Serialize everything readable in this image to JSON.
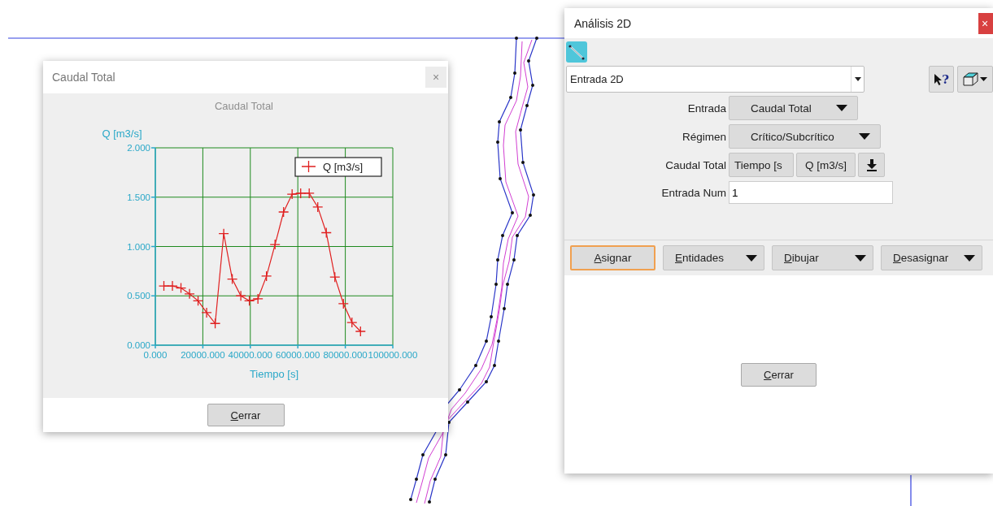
{
  "chart_window": {
    "title": "Caudal Total",
    "close_label": "×",
    "close_button": "Cerrar",
    "chart_data": {
      "type": "line",
      "title": "Caudal Total",
      "xlabel": "Tiempo [s]",
      "ylabel": "Q [m3/s]",
      "x": [
        3600,
        7200,
        10800,
        14400,
        18000,
        21600,
        25200,
        28800,
        32400,
        36000,
        39600,
        43200,
        46800,
        50400,
        54000,
        57600,
        61200,
        64800,
        68400,
        72000,
        75600,
        79200,
        82800,
        86400
      ],
      "grid": true,
      "series": [
        {
          "name": "Q [m3/s]",
          "color": "#e02020",
          "marker": "+",
          "values": [
            0.6,
            0.6,
            0.58,
            0.52,
            0.45,
            0.33,
            0.22,
            1.13,
            0.67,
            0.5,
            0.45,
            0.47,
            0.7,
            1.02,
            1.35,
            1.53,
            1.54,
            1.54,
            1.4,
            1.14,
            0.69,
            0.42,
            0.23,
            0.14
          ]
        }
      ],
      "xlim": [
        0,
        100000
      ],
      "ylim": [
        0,
        2
      ],
      "xticks": [
        {
          "value": 0,
          "label": "0.000"
        },
        {
          "value": 20000,
          "label": "20000.000"
        },
        {
          "value": 40000,
          "label": "40000.000"
        },
        {
          "value": 60000,
          "label": "60000.000"
        },
        {
          "value": 80000,
          "label": "80000.000"
        },
        {
          "value": 100000,
          "label": "100000.000"
        }
      ],
      "yticks": [
        {
          "value": 0,
          "label": "0.000"
        },
        {
          "value": 0.5,
          "label": "0.500"
        },
        {
          "value": 1,
          "label": "1.000"
        },
        {
          "value": 1.5,
          "label": "1.500"
        },
        {
          "value": 2,
          "label": "2.000"
        }
      ]
    }
  },
  "analysis_window": {
    "title": "Análisis 2D",
    "close_label": "×",
    "mode_selector": {
      "value": "Entrada 2D"
    },
    "help_button": "?",
    "fields": [
      {
        "label": "Entrada",
        "kind": "dropdown",
        "value": "Caudal Total"
      },
      {
        "label": "Régimen",
        "kind": "dropdown",
        "value": "Crítico/Subcrítico"
      },
      {
        "label": "Caudal Total",
        "kind": "table",
        "columns": [
          "Tiempo [s",
          "Q [m3/s]"
        ]
      },
      {
        "label": "Entrada Num",
        "kind": "input",
        "value": "1"
      }
    ],
    "actions": [
      {
        "label": "Asignar",
        "dropdown": false,
        "focused": true
      },
      {
        "label": "Entidades",
        "dropdown": true,
        "focused": false
      },
      {
        "label": "Dibujar",
        "dropdown": true,
        "focused": false
      },
      {
        "label": "Desasignar",
        "dropdown": true,
        "focused": false
      }
    ],
    "close_button": "Cerrar"
  }
}
